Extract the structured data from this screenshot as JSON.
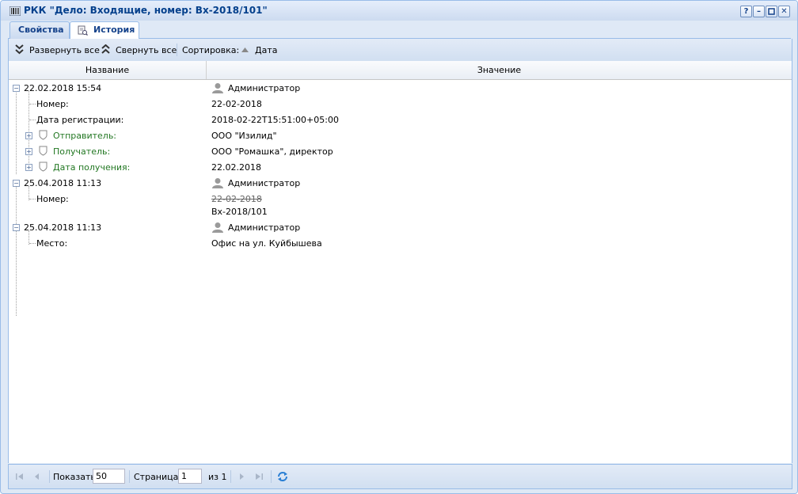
{
  "window": {
    "title": "РКК \"Дело: Входящие, номер: Вх-2018/101\""
  },
  "tabs": [
    {
      "label": "Свойства",
      "active": false
    },
    {
      "label": "История",
      "active": true
    }
  ],
  "toolbar": {
    "expand_all": "Развернуть все",
    "collapse_all": "Свернуть все",
    "sort_label": "Сортировка:",
    "sort_field": "Дата"
  },
  "grid": {
    "columns": [
      "Название",
      "Значение"
    ],
    "groups": [
      {
        "date": "22.02.2018 15:54",
        "user": "Администратор",
        "fields": [
          {
            "name": "Номер:",
            "value": "22-02-2018"
          },
          {
            "name": "Дата регистрации:",
            "value": "2018-02-22T15:51:00+05:00"
          },
          {
            "name": "Отправитель:",
            "value": "ООО \"Изилид\""
          },
          {
            "name": "Получатель:",
            "value": "ООО \"Ромашка\", директор"
          },
          {
            "name": "Дата получения:",
            "value": "22.02.2018"
          }
        ]
      },
      {
        "date": "25.04.2018 11:13",
        "user": "Администратор",
        "fields": [
          {
            "name": "Номер:",
            "old_value": "22-02-2018",
            "value": "Вх-2018/101"
          }
        ]
      },
      {
        "date": "25.04.2018 11:13",
        "user": "Администратор",
        "fields": [
          {
            "name": "Место:",
            "value": "Офис на ул. Куйбышева"
          }
        ]
      }
    ]
  },
  "pager": {
    "show_label": "Показать",
    "page_size": "50",
    "page_label": "Страница",
    "page": "1",
    "of_label": "из 1"
  },
  "colors": {
    "accent": "#15428b",
    "field_link": "#227722",
    "border": "#99bce8"
  }
}
